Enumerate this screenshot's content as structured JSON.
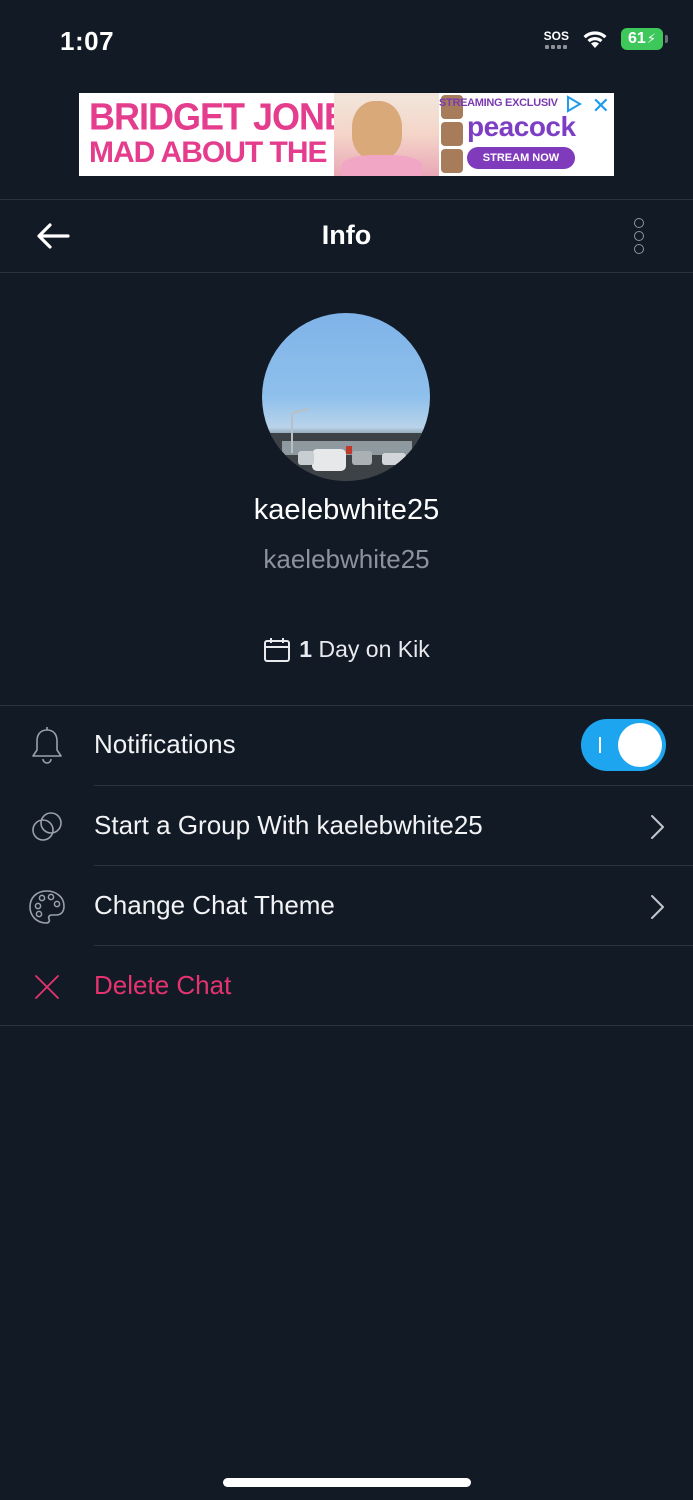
{
  "status_bar": {
    "time": "1:07",
    "sos": "SOS",
    "battery": "61"
  },
  "ad": {
    "headline": "BRIDGET JONES",
    "subheadline": "MAD ABOUT THE BOY",
    "streaming_text": "STREAMING EXCLUSIV",
    "brand": "peacock",
    "cta": "STREAM NOW",
    "close_icon": "close-icon"
  },
  "header": {
    "title": "Info",
    "back_icon": "arrow-left-icon",
    "more_icon": "more-vertical-icon"
  },
  "profile": {
    "display_name": "kaelebwhite25",
    "username": "kaelebwhite25",
    "days_count": "1",
    "days_suffix": "Day on Kik"
  },
  "menu": {
    "notifications": {
      "label": "Notifications",
      "icon": "bell-icon",
      "enabled": true
    },
    "start_group": {
      "label": "Start a Group With kaelebwhite25",
      "icon": "group-circles-icon"
    },
    "change_theme": {
      "label": "Change Chat Theme",
      "icon": "palette-icon"
    },
    "delete_chat": {
      "label": "Delete Chat",
      "icon": "close-x-icon"
    }
  },
  "colors": {
    "background": "#121a26",
    "accent_toggle": "#1ea5f0",
    "danger": "#e5336f",
    "muted_text": "#8c939d"
  }
}
